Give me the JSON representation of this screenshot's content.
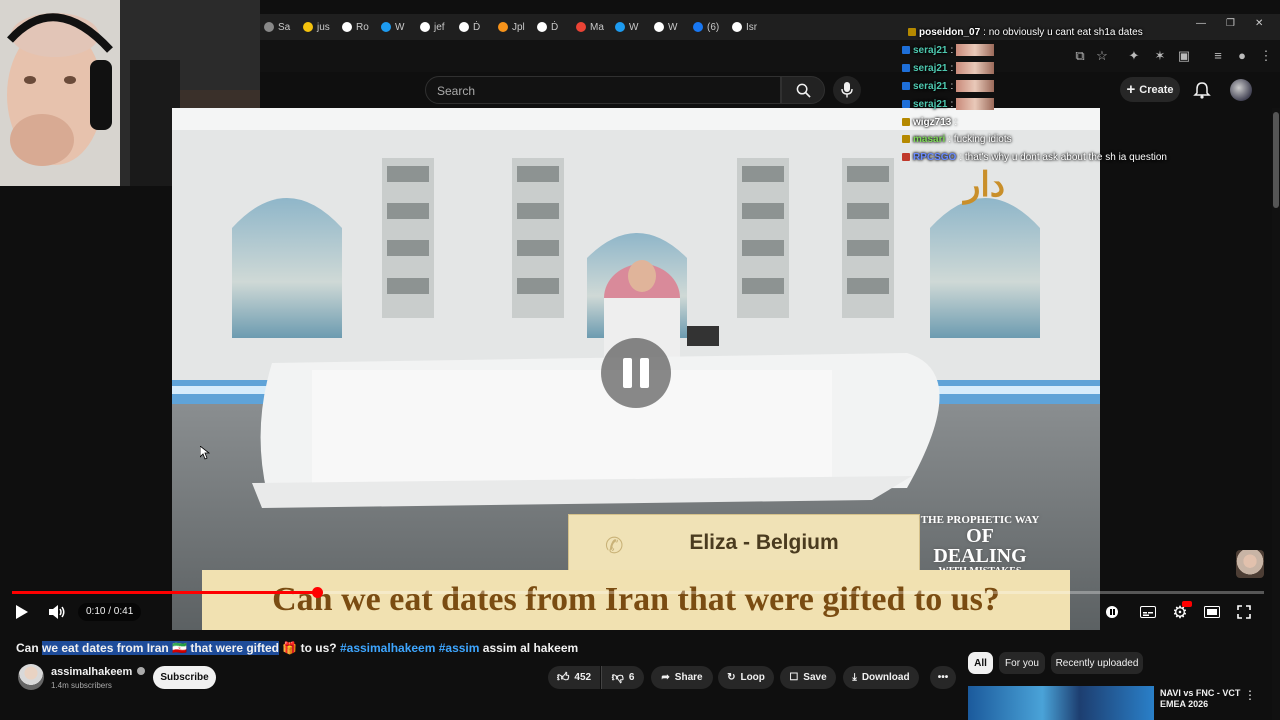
{
  "browser": {
    "tabs": [
      {
        "label": "Sa",
        "color": "#888888"
      },
      {
        "label": "jus",
        "color": "#f4c20d"
      },
      {
        "label": "Ro",
        "color": "#ffffff"
      },
      {
        "label": "W",
        "color": "#1d9bf0"
      },
      {
        "label": "jef",
        "color": "#ffffff"
      },
      {
        "label": "Ḋ",
        "color": "#ffffff"
      },
      {
        "label": "Jpl",
        "color": "#f7931a"
      },
      {
        "label": "Ḋ",
        "color": "#ffffff"
      },
      {
        "label": "Ma",
        "color": "#ea4335"
      },
      {
        "label": "W",
        "color": "#1d9bf0"
      },
      {
        "label": "W",
        "color": "#ffffff"
      },
      {
        "label": "(6)",
        "color": "#1877f2"
      },
      {
        "label": "Isr",
        "color": "#ffffff"
      }
    ],
    "window_controls": [
      "—",
      "❐",
      "✕"
    ]
  },
  "youtube_header": {
    "search_placeholder": "Search",
    "create_label": "Create"
  },
  "chat": {
    "lines": [
      {
        "user": "poseidon_07",
        "message": ": no obviously u cant eat sh1a dates",
        "color": "#ffffff",
        "emote": false
      },
      {
        "user": "seraj21",
        "message": ":",
        "color": "#4ec9b0",
        "emote": true
      },
      {
        "user": "seraj21",
        "message": ":",
        "color": "#4ec9b0",
        "emote": true
      },
      {
        "user": "seraj21",
        "message": ":",
        "color": "#4ec9b0",
        "emote": true
      },
      {
        "user": "seraj21",
        "message": ":",
        "color": "#4ec9b0",
        "emote": true
      },
      {
        "user": "wigz713",
        "message": ":",
        "color": "#ffffff",
        "emote": false
      },
      {
        "user": "masari",
        "message": ": fucking idiots",
        "color": "#7ed957",
        "emote": false
      },
      {
        "user": "RPCSGO",
        "message": ": that's why u dont ask about the sh ia question",
        "color": "#6a8bff",
        "emote": false
      }
    ]
  },
  "video": {
    "caller_label": "Eliza - Belgium",
    "show_logo": [
      "THE PROPHETIC WAY",
      "OF DEALING",
      "WITH MISTAKES"
    ],
    "caption": "Can we eat dates from Iran that were gifted to us?",
    "progress": 0.244,
    "time_display": "0:10 / 0:41"
  },
  "title": {
    "prefix": "Can ",
    "highlighted": "we eat dates from Iran 🇮🇷 that were gifted",
    "gift": "🎁",
    "middle": " to us? ",
    "tag1": "#assimalhakeem",
    "tag2": "#assim",
    "suffix": " assim al hakeem"
  },
  "channel": {
    "name": "assimalhakeem",
    "subscribers": "1.4m subscribers",
    "subscribe_label": "Subscribe"
  },
  "actions": {
    "likes": "452",
    "dislikes": "6",
    "share": "Share",
    "loop": "Loop",
    "save": "Save",
    "download": "Download"
  },
  "chips": [
    "All",
    "For you",
    "Recently uploaded"
  ],
  "recommended": {
    "title": "NAVI vs FNC - VCT EMEA 2026"
  }
}
